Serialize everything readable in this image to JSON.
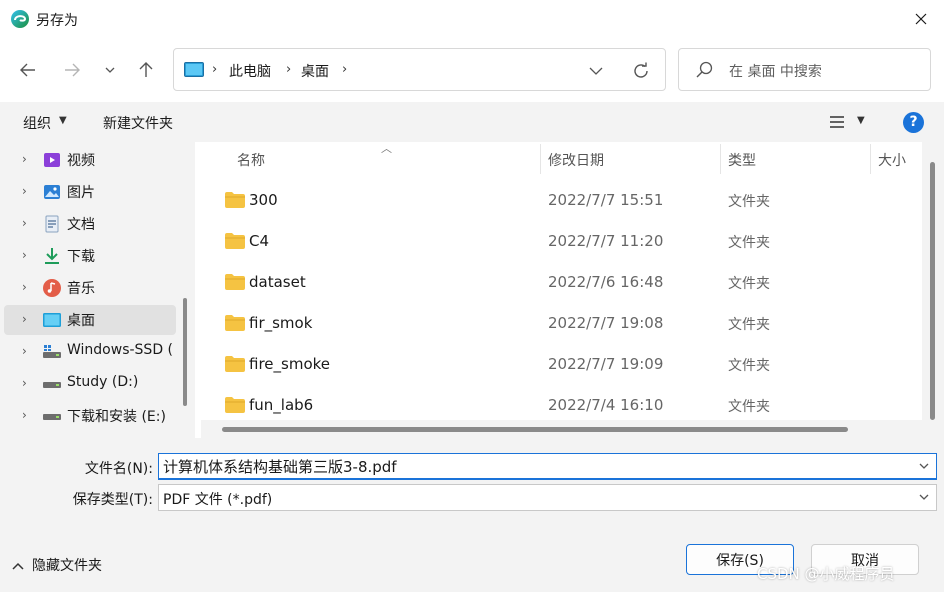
{
  "window": {
    "title": "另存为"
  },
  "nav": {
    "breadcrumbs": [
      "此电脑",
      "桌面"
    ],
    "search_placeholder": "在 桌面 中搜索"
  },
  "commandbar": {
    "organize": "组织",
    "new_folder": "新建文件夹"
  },
  "sidebar": {
    "items": [
      {
        "label": "视频",
        "icon": "video-icon"
      },
      {
        "label": "图片",
        "icon": "pictures-icon"
      },
      {
        "label": "文档",
        "icon": "documents-icon"
      },
      {
        "label": "下载",
        "icon": "download-icon"
      },
      {
        "label": "音乐",
        "icon": "music-icon"
      },
      {
        "label": "桌面",
        "icon": "desktop-icon",
        "selected": true
      },
      {
        "label": "Windows-SSD (",
        "icon": "drive-icon"
      },
      {
        "label": "Study (D:)",
        "icon": "drive-icon"
      },
      {
        "label": "下载和安装 (E:)",
        "icon": "drive-icon"
      }
    ]
  },
  "files": {
    "columns": {
      "name": "名称",
      "modified": "修改日期",
      "type": "类型",
      "size": "大小"
    },
    "rows": [
      {
        "name": "300",
        "modified": "2022/7/7 15:51",
        "type": "文件夹"
      },
      {
        "name": "C4",
        "modified": "2022/7/7 11:20",
        "type": "文件夹"
      },
      {
        "name": "dataset",
        "modified": "2022/7/6 16:48",
        "type": "文件夹"
      },
      {
        "name": "fir_smok",
        "modified": "2022/7/7 19:08",
        "type": "文件夹"
      },
      {
        "name": "fire_smoke",
        "modified": "2022/7/7 19:09",
        "type": "文件夹"
      },
      {
        "name": "fun_lab6",
        "modified": "2022/7/4 16:10",
        "type": "文件夹"
      }
    ]
  },
  "form": {
    "filename_label": "文件名(N):",
    "filename_value": "计算机体系结构基础第三版3-8.pdf",
    "filetype_label": "保存类型(T):",
    "filetype_value": "PDF 文件 (*.pdf)"
  },
  "footer": {
    "hide_folders": "隐藏文件夹",
    "save": "保存(S)",
    "cancel": "取消",
    "watermark": "CSDN @小威程序员"
  },
  "colors": {
    "accent": "#1a73d9",
    "folder": "#f5c342",
    "panel": "#f3f3f3"
  }
}
